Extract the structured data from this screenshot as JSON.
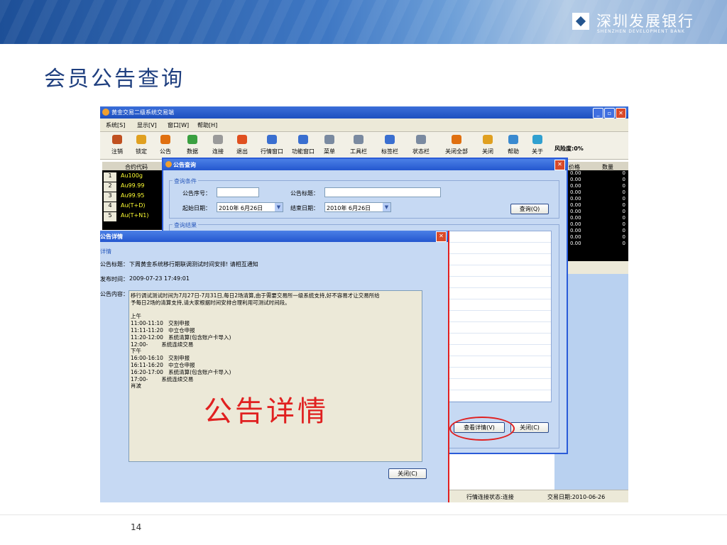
{
  "page": {
    "title": "会员公告查询",
    "page_number": "14"
  },
  "bank": {
    "name_cn": "深圳发展银行",
    "name_en": "SHENZHEN DEVELOPMENT BANK"
  },
  "window": {
    "title": "黄金交易二级系统交易端"
  },
  "menu": [
    "系统[S]",
    "显示[V]",
    "窗口[W]",
    "帮助[H]"
  ],
  "toolbar": {
    "items": [
      {
        "label": "注销",
        "icon": "logout-icon",
        "color": "#c05020"
      },
      {
        "label": "锁定",
        "icon": "lock-icon",
        "color": "#e0a020"
      },
      {
        "label": "公告",
        "icon": "notice-icon",
        "color": "#e07010"
      },
      {
        "label": "数据",
        "icon": "data-icon",
        "color": "#3aa040"
      },
      {
        "label": "连接",
        "icon": "connect-icon",
        "color": "#9a9a9a"
      },
      {
        "label": "退出",
        "icon": "exit-icon",
        "color": "#e05020"
      },
      {
        "label": "行情窗口",
        "icon": "quote-window-icon",
        "color": "#3a6fd0"
      },
      {
        "label": "功能窗口",
        "icon": "function-window-icon",
        "color": "#3a6fd0"
      },
      {
        "label": "菜单",
        "icon": "menu-icon",
        "color": "#7a8aa0"
      },
      {
        "label": "工具栏",
        "icon": "toolbar-icon",
        "color": "#7a8aa0"
      },
      {
        "label": "标签栏",
        "icon": "tabbar-icon",
        "color": "#3a6fd0"
      },
      {
        "label": "状态栏",
        "icon": "statusbar-icon",
        "color": "#7a8aa0"
      },
      {
        "label": "关闭全部",
        "icon": "close-all-icon",
        "color": "#e07010"
      },
      {
        "label": "关闭",
        "icon": "close-icon",
        "color": "#e0a020"
      },
      {
        "label": "帮助",
        "icon": "help-icon",
        "color": "#3a8ad0"
      },
      {
        "label": "关于",
        "icon": "about-icon",
        "color": "#30a0d0"
      }
    ],
    "risk": "风险度:0%"
  },
  "quote_list": {
    "header": "合约代码",
    "rows": [
      {
        "n": "1",
        "code": "Au100g"
      },
      {
        "n": "2",
        "code": "Au99.99"
      },
      {
        "n": "3",
        "code": "Au99.95"
      },
      {
        "n": "4",
        "code": "Au(T+D)"
      },
      {
        "n": "5",
        "code": "Au(T+N1)"
      }
    ]
  },
  "right_list": {
    "headers": [
      "价格",
      "数量"
    ],
    "rows": [
      {
        "price": "0.00",
        "qty": "0"
      },
      {
        "price": "0.00",
        "qty": "0"
      },
      {
        "price": "0.00",
        "qty": "0"
      },
      {
        "price": "0.00",
        "qty": "0"
      },
      {
        "price": "0.00",
        "qty": "0"
      },
      {
        "price": "0.00",
        "qty": "0"
      },
      {
        "price": "0.00",
        "qty": "0"
      },
      {
        "price": "0.00",
        "qty": "0"
      },
      {
        "price": "0.00",
        "qty": "0"
      },
      {
        "price": "0.00",
        "qty": "0"
      },
      {
        "price": "0.00",
        "qty": "0"
      },
      {
        "price": "0.00",
        "qty": "0"
      }
    ]
  },
  "query_dialog": {
    "title": "公告查询",
    "group_conditions": "查询条件",
    "serial_label": "公告序号：",
    "serial_value": "",
    "title_label": "公告标题：",
    "title_value": "",
    "start_label": "起始日期：",
    "start_value": "2010年 6月26日",
    "end_label": "结束日期：",
    "end_value": "2010年 6月26日",
    "query_button": "查询(Q)",
    "group_results": "查询结果",
    "detail_button": "查看详情(V)",
    "close_button": "关闭(C)"
  },
  "detail_dialog": {
    "title": "公告详情",
    "group": "详情",
    "title_label": "公告标题：",
    "title_value": "下周黄金系统移行期联调测试时间安排! 请相互通知",
    "time_label": "发布时间：",
    "time_value": "2009-07-23 17:49:01",
    "content_label": "公告内容：",
    "content": "移行调试测试时间为7月27日-7月31日,每日2场清算,由于需要交易所一级系统支持,好不容易才让交易所给\n予每日2场的清算支持,请大家根据时间安排合理利用可测试时间段。\n\n上午\n11:00-11:10   交割申报\n11:11-11:20   中立仓申报\n11:20-12:00   系统清算(包含账户卡导入)\n12:00-        系统连续交易\n下午\n16:00-16:10   交割申报\n16:11-16:20   中立仓申报\n16:20-17:00   系统清算(包含账户卡导入)\n17:00-        系统连续交易\n肖波",
    "close_button": "关闭(C)",
    "annotation": "公告详情"
  },
  "statusbar": {
    "connection": "行情连接状态:连接",
    "trade_date": "交易日期:2010-06-26"
  }
}
